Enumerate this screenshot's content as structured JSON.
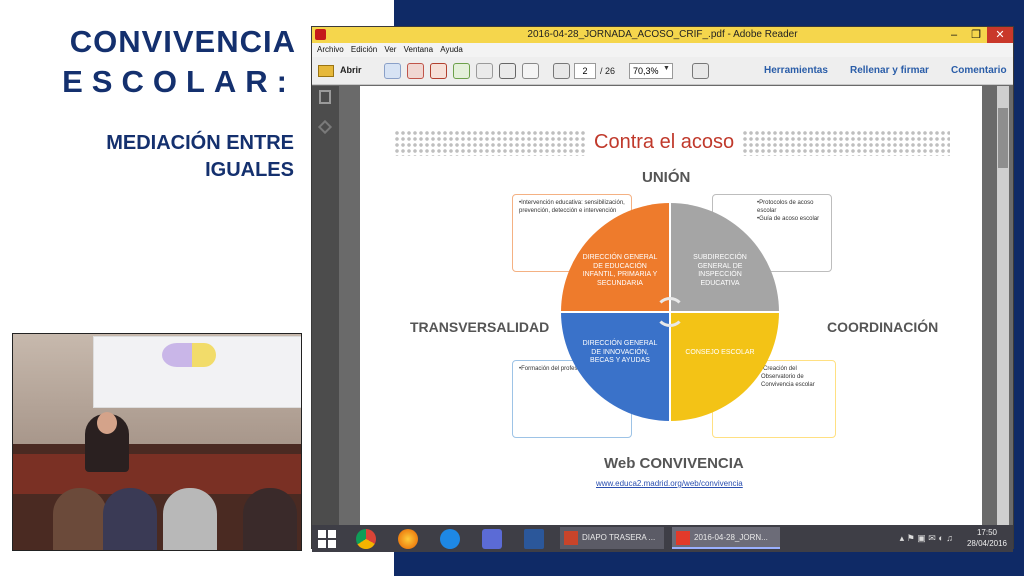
{
  "slide": {
    "title_line1": "CONVIVENCIA",
    "title_line2": "ESCOLAR:",
    "subtitle_line1": "MEDIACIÓN ENTRE",
    "subtitle_line2": "IGUALES"
  },
  "window": {
    "title": "2016-04-28_JORNADA_ACOSO_CRIF_.pdf - Adobe Reader",
    "minimize": "–",
    "maximize": "❐",
    "close": "✕"
  },
  "menu": [
    "Archivo",
    "Edición",
    "Ver",
    "Ventana",
    "Ayuda"
  ],
  "toolbar": {
    "open_label": "Abrir",
    "page_current": "2",
    "page_total": "/ 26",
    "zoom": "70,3%",
    "tools": "Herramientas",
    "fill_sign": "Rellenar y firmar",
    "comment": "Comentario"
  },
  "document": {
    "title": "Contra el acoso",
    "label_top": "UNIÓN",
    "label_left": "TRANSVERSALIDAD",
    "label_right": "COORDINACIÓN",
    "label_bottom": "Web CONVIVENCIA",
    "url": "www.educa2.madrid.org/web/convivencia",
    "quadrant_tl": "DIRECCIÓN GENERAL DE EDUCACIÓN INFANTIL, PRIMARIA Y SECUNDARIA",
    "quadrant_tr": "SUBDIRECCIÓN GENERAL DE INSPECCIÓN EDUCATIVA",
    "quadrant_bl": "DIRECCIÓN GENERAL DE INNOVACIÓN, BECAS Y AYUDAS",
    "quadrant_br": "CONSEJO ESCOLAR",
    "note_tl": "•Intervención educativa: sensibilización, prevención, detección e intervención",
    "note_tr_1": "•Protocolos de acoso escolar",
    "note_tr_2": "•Guía de acoso escolar",
    "note_bl": "•Formación del profesorado",
    "note_br": "•Creación del Observatorio de Convivencia escolar"
  },
  "taskbar": {
    "app1": "DIAPO TRASERA ...",
    "app2": "2016-04-28_JORN...",
    "time": "17:50",
    "date": "28/04/2016"
  },
  "colors": {
    "background": "#0f2a66",
    "title_text": "#14306e",
    "orange": "#ee7b2c",
    "gray": "#a5a5a5",
    "blue": "#3a72c9",
    "yellow": "#f3c316",
    "window_title_bar": "#f5d64c"
  }
}
